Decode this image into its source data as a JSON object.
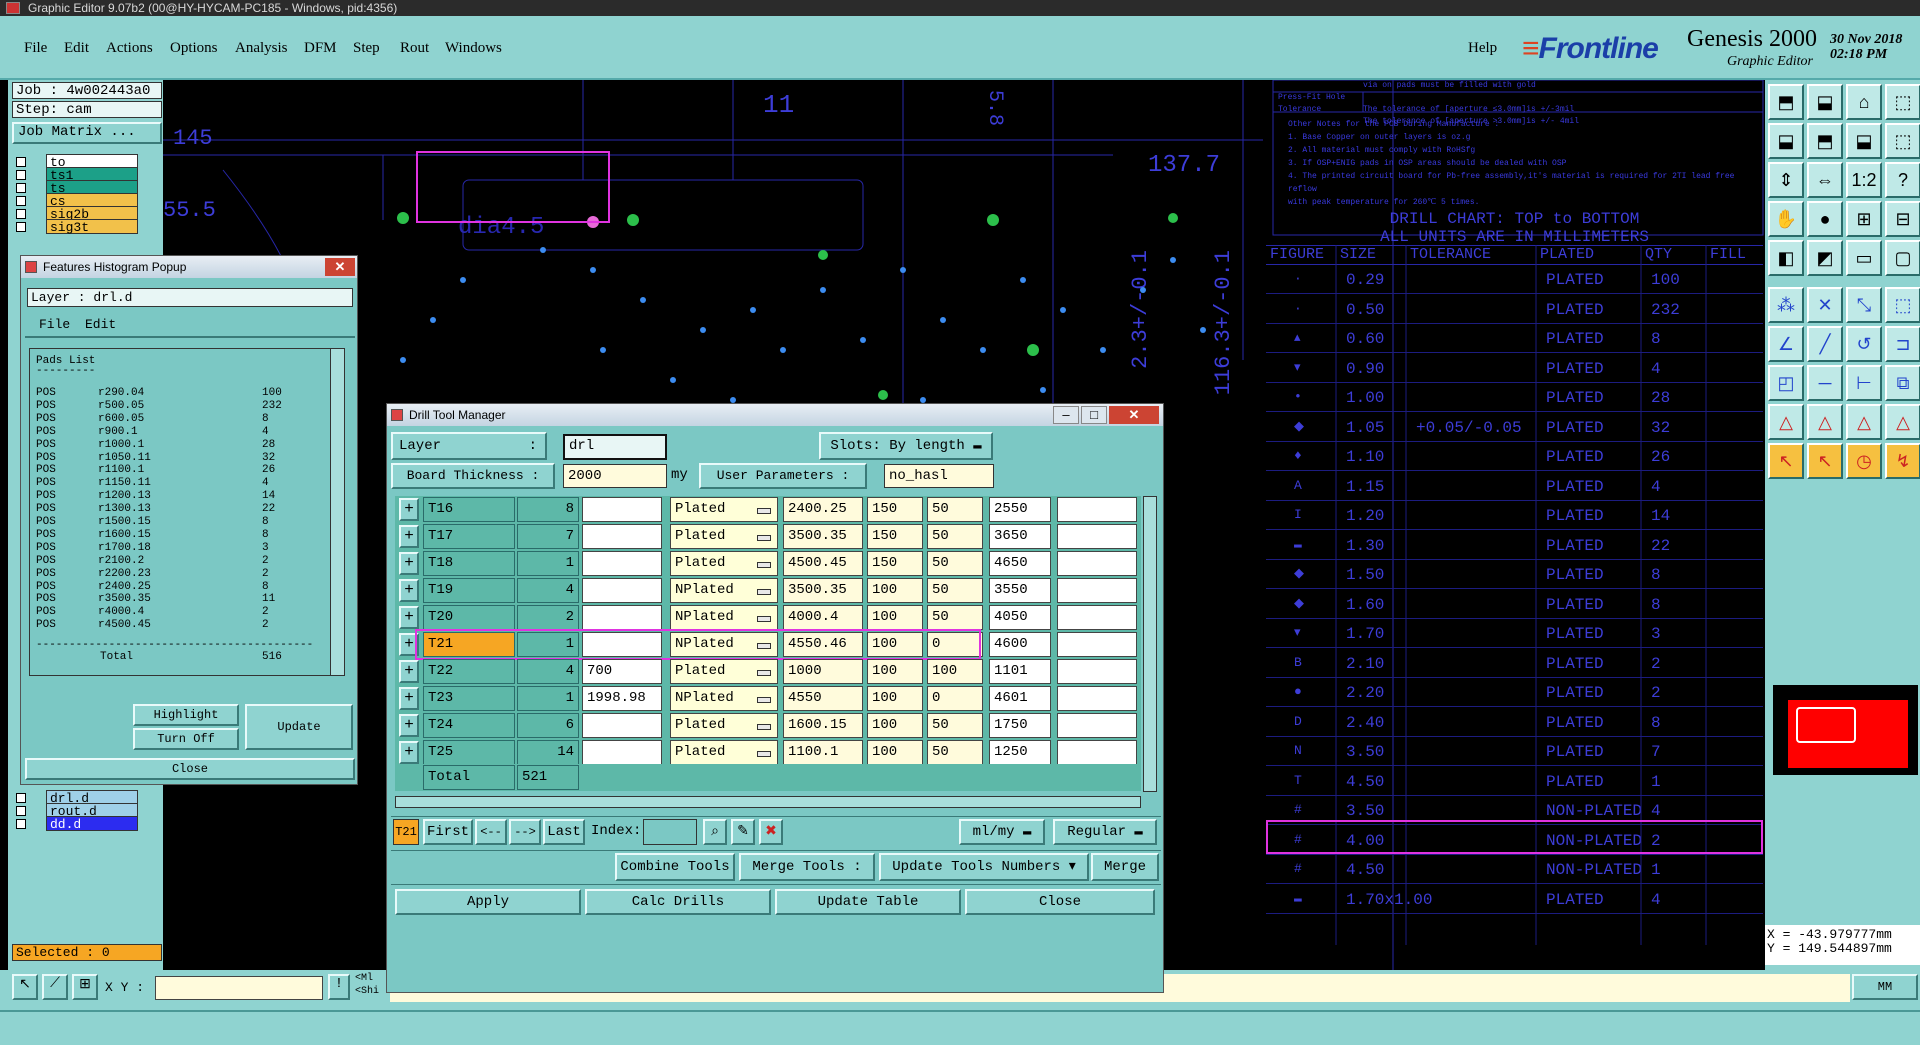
{
  "window": {
    "title": "Graphic Editor 9.07b2 (00@HY-HYCAM-PC185 - Windows, pid:4356)"
  },
  "menu": {
    "items": [
      "File",
      "Edit",
      "Actions",
      "Options",
      "Analysis",
      "DFM",
      "Step",
      "Rout",
      "Windows"
    ],
    "help": "Help"
  },
  "brand": {
    "logo": "Frontline",
    "product": "Genesis 2000",
    "subtitle": "Graphic Editor",
    "date": "30 Nov 2018",
    "time": "02:18 PM"
  },
  "left": {
    "job": "Job : 4w002443a0",
    "step": "Step: cam",
    "job_matrix": "Job Matrix ...",
    "layers_top": [
      {
        "name": "to",
        "color": "#ffffff"
      },
      {
        "name": "ts1",
        "color": "#1ca088"
      },
      {
        "name": "ts",
        "color": "#1ca088"
      },
      {
        "name": "cs",
        "color": "#f2c14a"
      },
      {
        "name": "sig2b",
        "color": "#f2c14a"
      },
      {
        "name": "sig3t",
        "color": "#f2c14a"
      }
    ],
    "layers_bottom": [
      {
        "name": "drl.d",
        "color": "#9fd0e8"
      },
      {
        "name": "rout.d",
        "color": "#9fd0e8"
      },
      {
        "name": "dd.d",
        "color": "#2c2cf0"
      }
    ],
    "selected": "Selected : 0"
  },
  "histogram": {
    "title": "Features Histogram Popup",
    "layer": "Layer :   drl.d",
    "menu": [
      "File",
      "Edit"
    ],
    "list_title": "Pads List",
    "rows": [
      [
        "POS",
        "r290.04",
        "100"
      ],
      [
        "POS",
        "r500.05",
        "232"
      ],
      [
        "POS",
        "r600.05",
        "8"
      ],
      [
        "POS",
        "r900.1",
        "4"
      ],
      [
        "POS",
        "r1000.1",
        "28"
      ],
      [
        "POS",
        "r1050.11",
        "32"
      ],
      [
        "POS",
        "r1100.1",
        "26"
      ],
      [
        "POS",
        "r1150.11",
        "4"
      ],
      [
        "POS",
        "r1200.13",
        "14"
      ],
      [
        "POS",
        "r1300.13",
        "22"
      ],
      [
        "POS",
        "r1500.15",
        "8"
      ],
      [
        "POS",
        "r1600.15",
        "8"
      ],
      [
        "POS",
        "r1700.18",
        "3"
      ],
      [
        "POS",
        "r2100.2",
        "2"
      ],
      [
        "POS",
        "r2200.23",
        "2"
      ],
      [
        "POS",
        "r2400.25",
        "8"
      ],
      [
        "POS",
        "r3500.35",
        "11"
      ],
      [
        "POS",
        "r4000.4",
        "2"
      ],
      [
        "POS",
        "r4500.45",
        "2"
      ]
    ],
    "total_label": "Total",
    "total": "516",
    "highlight": "Highlight",
    "turn_off": "Turn Off",
    "update": "Update",
    "close": "Close"
  },
  "dtm": {
    "title": "Drill Tool Manager",
    "layer_label": "Layer",
    "layer_value": "drl",
    "slots_label": "Slots:",
    "slots_value": "By length",
    "thickness_label": "Board Thickness :",
    "thickness_value": "2000",
    "thickness_unit": "my",
    "user_params_label": "User Parameters :",
    "user_params_value": "no_hasl",
    "rows": [
      {
        "tool": "T16",
        "count": "8",
        "finish": "",
        "type": "Plated",
        "drill": "2400.25",
        "c1": "150",
        "c2": "50",
        "size": "2550",
        "extra": ""
      },
      {
        "tool": "T17",
        "count": "7",
        "finish": "",
        "type": "Plated",
        "drill": "3500.35",
        "c1": "150",
        "c2": "50",
        "size": "3650",
        "extra": ""
      },
      {
        "tool": "T18",
        "count": "1",
        "finish": "",
        "type": "Plated",
        "drill": "4500.45",
        "c1": "150",
        "c2": "50",
        "size": "4650",
        "extra": ""
      },
      {
        "tool": "T19",
        "count": "4",
        "finish": "",
        "type": "NPlated",
        "drill": "3500.35",
        "c1": "100",
        "c2": "50",
        "size": "3550",
        "extra": ""
      },
      {
        "tool": "T20",
        "count": "2",
        "finish": "",
        "type": "NPlated",
        "drill": "4000.4",
        "c1": "100",
        "c2": "50",
        "size": "4050",
        "extra": ""
      },
      {
        "tool": "T21",
        "count": "1",
        "finish": "",
        "type": "NPlated",
        "drill": "4550.46",
        "c1": "100",
        "c2": "0",
        "size": "4600",
        "extra": ""
      },
      {
        "tool": "T22",
        "count": "4",
        "finish": "700",
        "type": "Plated",
        "drill": "1000",
        "c1": "100",
        "c2": "100",
        "size": "1101",
        "extra": ""
      },
      {
        "tool": "T23",
        "count": "1",
        "finish": "1998.98",
        "type": "NPlated",
        "drill": "4550",
        "c1": "100",
        "c2": "0",
        "size": "4601",
        "extra": ""
      },
      {
        "tool": "T24",
        "count": "6",
        "finish": "",
        "type": "Plated",
        "drill": "1600.15",
        "c1": "100",
        "c2": "50",
        "size": "1750",
        "extra": ""
      },
      {
        "tool": "T25",
        "count": "14",
        "finish": "",
        "type": "Plated",
        "drill": "1100.1",
        "c1": "100",
        "c2": "50",
        "size": "1250",
        "extra": ""
      }
    ],
    "total_label": "Total",
    "total": "521",
    "nav_current": "T21",
    "first": "First",
    "prev": "<--",
    "next": "-->",
    "last": "Last",
    "index_label": "Index:",
    "unit_combo": "ml/my",
    "mode_combo": "Regular",
    "combine": "Combine Tools",
    "merge_label": "Merge Tools :",
    "update_numbers": "Update Tools Numbers",
    "merge": "Merge",
    "apply": "Apply",
    "calc": "Calc Drills",
    "update_table": "Update Table",
    "close": "Close"
  },
  "drill_chart": {
    "title": "DRILL CHART: TOP to BOTTOM",
    "subtitle": "ALL UNITS ARE IN MILLIMETERS",
    "headers": [
      "FIGURE",
      "SIZE",
      "TOLERANCE",
      "PLATED",
      "QTY",
      "FILL"
    ],
    "rows": [
      [
        "·",
        "0.29",
        "",
        "PLATED",
        "100"
      ],
      [
        "·",
        "0.50",
        "",
        "PLATED",
        "232"
      ],
      [
        "▴",
        "0.60",
        "",
        "PLATED",
        "8"
      ],
      [
        "▾",
        "0.90",
        "",
        "PLATED",
        "4"
      ],
      [
        "•",
        "1.00",
        "",
        "PLATED",
        "28"
      ],
      [
        "◆",
        "1.05",
        "+0.05/-0.05",
        "PLATED",
        "32"
      ],
      [
        "♦",
        "1.10",
        "",
        "PLATED",
        "26"
      ],
      [
        "A",
        "1.15",
        "",
        "PLATED",
        "4"
      ],
      [
        "I",
        "1.20",
        "",
        "PLATED",
        "14"
      ],
      [
        "▬",
        "1.30",
        "",
        "PLATED",
        "22"
      ],
      [
        "◆",
        "1.50",
        "",
        "PLATED",
        "8"
      ],
      [
        "◆",
        "1.60",
        "",
        "PLATED",
        "8"
      ],
      [
        "▾",
        "1.70",
        "",
        "PLATED",
        "3"
      ],
      [
        "B",
        "2.10",
        "",
        "PLATED",
        "2"
      ],
      [
        "●",
        "2.20",
        "",
        "PLATED",
        "2"
      ],
      [
        "D",
        "2.40",
        "",
        "PLATED",
        "8"
      ],
      [
        "N",
        "3.50",
        "",
        "PLATED",
        "7"
      ],
      [
        "T",
        "4.50",
        "",
        "PLATED",
        "1"
      ],
      [
        "#",
        "3.50",
        "",
        "NON-PLATED",
        "4"
      ],
      [
        "#",
        "4.00",
        "",
        "NON-PLATED",
        "2"
      ],
      [
        "#",
        "4.50",
        "",
        "NON-PLATED",
        "1"
      ],
      [
        "▬",
        "1.70x1.00",
        "",
        "PLATED",
        "4"
      ]
    ]
  },
  "cad_labels": {
    "dim_11": "11",
    "dim_145": "145",
    "dim_55": "55.5",
    "dim_1377": "137.7",
    "dia": "dia4.5",
    "dim_58": "5.8",
    "vertical_1": "2.3+/-0.1",
    "vertical_2": "116.3+/-0.1",
    "note_title": "Other Notes for the PCB During Manufacture :",
    "note_1": "1. Base Copper on outer layers is      oz.g",
    "note_2": "2. All material must comply with RoHSfg",
    "note_3": "3. If  OSP+ENIG pads in OSP areas should be dealed with OSP",
    "note_4": "4. The printed circuit board for Pb-free assembly,it's material is required for 2TI lead free reflow",
    "note_5": "   with peak temperature for 260℃ 5 times.",
    "pf_title": "Press-Fit Hole Tolerance",
    "pf_1": "The tolerance of  [aperture ≤3.0mm]is +/-3mil",
    "pf_2": "The tolerance of  [aperture >3.0mm]is +/- 4mil",
    "pf_top": "via on pads must be filled with gold"
  },
  "coords": {
    "x": "X = -43.979777mm",
    "y": "Y = 149.544897mm"
  },
  "status": {
    "xy_label": "X Y :",
    "xy_value": "",
    "unit": "MM",
    "msg1": "<Ml",
    "msg2": "<Shi"
  },
  "colors": {
    "panel": "#8fd3d0",
    "highlight": "#e033e0",
    "selected": "#f6a623",
    "red_preview": "#ff0000"
  }
}
